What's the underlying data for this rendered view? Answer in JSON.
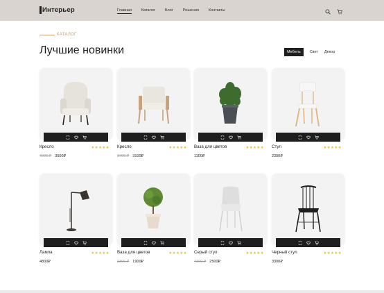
{
  "header": {
    "logo": "Интерьер",
    "nav": [
      {
        "label": "Главная",
        "active": true
      },
      {
        "label": "Каталог",
        "active": false
      },
      {
        "label": "Блог",
        "active": false
      },
      {
        "label": "Решения",
        "active": false
      },
      {
        "label": "Контакты",
        "active": false
      }
    ],
    "icons": [
      "search-icon",
      "cart-icon"
    ]
  },
  "section": {
    "eyebrow": "КАТАЛОГ",
    "title": "Лучшие новинки",
    "filters": [
      {
        "label": "Мебель",
        "active": true
      },
      {
        "label": "Свет",
        "active": false
      },
      {
        "label": "Декор",
        "active": false
      }
    ]
  },
  "products": [
    {
      "name": "Кресло",
      "old_price": "4000 ₽",
      "price": "3500₽",
      "rating": 5,
      "image": "armchair-white"
    },
    {
      "name": "Кресло",
      "old_price": "3400 ₽",
      "price": "3100₽",
      "rating": 5,
      "image": "armchair-wood"
    },
    {
      "name": "Ваза для цветов",
      "old_price": "",
      "price": "1100₽",
      "rating": 5,
      "image": "potted-herb"
    },
    {
      "name": "Стул",
      "old_price": "",
      "price": "2300₽",
      "rating": 5,
      "image": "chair-white-wood"
    },
    {
      "name": "Лампа",
      "old_price": "",
      "price": "4800₽",
      "rating": 5,
      "image": "floor-lamp"
    },
    {
      "name": "Ваза для цветов",
      "old_price": "2300 ₽",
      "price": "1900₽",
      "rating": 5,
      "image": "topiary-tree"
    },
    {
      "name": "Серый стул",
      "old_price": "4100 ₽",
      "price": "2500₽",
      "rating": 5,
      "image": "chair-grey"
    },
    {
      "name": "Черный стул",
      "old_price": "",
      "price": "3300₽",
      "rating": 5,
      "image": "chair-black-windsor"
    }
  ],
  "card_actions": [
    "compare-icon",
    "heart-icon",
    "cart-icon"
  ],
  "colors": {
    "header_bg": "#d9d4cf",
    "accent": "#c2a07a",
    "stars": "#e8c13a",
    "dark": "#1e1e1e"
  }
}
